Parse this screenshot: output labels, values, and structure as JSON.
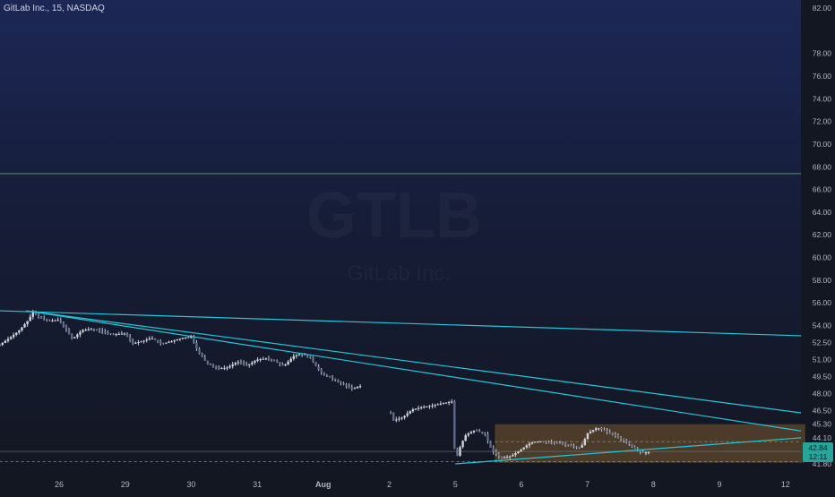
{
  "header": {
    "symbol_title": "GitLab Inc., 15, NASDAQ"
  },
  "watermark": {
    "ticker": "GTLB",
    "subtitle": "GitLab Inc."
  },
  "current_price": {
    "last": "42.84",
    "countdown": "12:11"
  },
  "colors": {
    "bg_top": "#1c2756",
    "bg_bottom": "#131722",
    "trendline": "#26c6da",
    "green_hline": "#4caf50",
    "box_fill": "#7a5a2e",
    "candle": "#d1d4dc",
    "axis_text": "#b2b5be",
    "price_tag": "#26a69a"
  },
  "chart_data": {
    "type": "candlestick",
    "y_axis": {
      "min": 41.0,
      "max": 82.9,
      "ticks": [
        "82.00",
        "78.00",
        "76.00",
        "74.00",
        "72.00",
        "70.00",
        "68.00",
        "66.00",
        "64.00",
        "62.00",
        "60.00",
        "58.00",
        "56.00",
        "54.00",
        "52.50",
        "51.00",
        "49.50",
        "48.00",
        "46.50",
        "45.30",
        "44.10",
        "41.80"
      ]
    },
    "x_axis": {
      "labels": [
        {
          "label": "26",
          "x": 0
        },
        {
          "label": "29",
          "x": 1
        },
        {
          "label": "30",
          "x": 2
        },
        {
          "label": "31",
          "x": 3
        },
        {
          "label": "Aug",
          "x": 4
        },
        {
          "label": "2",
          "x": 5
        },
        {
          "label": "5",
          "x": 6
        },
        {
          "label": "6",
          "x": 7
        },
        {
          "label": "7",
          "x": 8
        },
        {
          "label": "8",
          "x": 9
        },
        {
          "label": "9",
          "x": 10
        },
        {
          "label": "12",
          "x": 11
        }
      ],
      "range": [
        -0.9,
        11.3
      ]
    },
    "price_path": [
      [
        -0.9,
        52.3
      ],
      [
        -0.75,
        52.9
      ],
      [
        -0.6,
        53.6
      ],
      [
        -0.45,
        54.6
      ],
      [
        -0.4,
        55.3
      ],
      [
        -0.3,
        54.7
      ],
      [
        -0.15,
        54.4
      ],
      [
        0.0,
        54.5
      ],
      [
        0.1,
        53.7
      ],
      [
        0.2,
        52.8
      ],
      [
        0.35,
        53.6
      ],
      [
        0.5,
        53.7
      ],
      [
        0.65,
        53.5
      ],
      [
        0.8,
        53.2
      ],
      [
        1.0,
        53.3
      ],
      [
        1.1,
        52.4
      ],
      [
        1.25,
        52.6
      ],
      [
        1.4,
        52.9
      ],
      [
        1.55,
        52.4
      ],
      [
        1.7,
        52.6
      ],
      [
        1.85,
        52.9
      ],
      [
        2.0,
        53.0
      ],
      [
        2.1,
        51.7
      ],
      [
        2.25,
        50.6
      ],
      [
        2.4,
        50.2
      ],
      [
        2.55,
        50.3
      ],
      [
        2.7,
        50.8
      ],
      [
        2.85,
        50.5
      ],
      [
        3.0,
        51.0
      ],
      [
        3.15,
        51.1
      ],
      [
        3.3,
        50.8
      ],
      [
        3.4,
        50.4
      ],
      [
        3.55,
        51.3
      ],
      [
        3.65,
        51.5
      ],
      [
        3.8,
        51.2
      ],
      [
        3.9,
        50.3
      ],
      [
        4.0,
        49.7
      ],
      [
        4.15,
        49.3
      ],
      [
        4.3,
        48.8
      ],
      [
        4.45,
        48.4
      ],
      [
        4.55,
        48.7
      ],
      [
        4.6,
        48.5
      ],
      [
        5.0,
        46.8
      ],
      [
        5.05,
        45.6
      ],
      [
        5.2,
        45.9
      ],
      [
        5.35,
        46.6
      ],
      [
        5.5,
        46.8
      ],
      [
        5.7,
        47.0
      ],
      [
        5.85,
        47.2
      ],
      [
        5.95,
        47.3
      ],
      [
        6.0,
        41.8
      ],
      [
        6.05,
        43.0
      ],
      [
        6.15,
        44.3
      ],
      [
        6.3,
        44.8
      ],
      [
        6.45,
        44.4
      ],
      [
        6.55,
        43.0
      ],
      [
        6.7,
        42.3
      ],
      [
        6.85,
        42.5
      ],
      [
        7.0,
        43.1
      ],
      [
        7.15,
        43.7
      ],
      [
        7.3,
        43.8
      ],
      [
        7.45,
        43.7
      ],
      [
        7.6,
        43.6
      ],
      [
        7.75,
        43.4
      ],
      [
        7.9,
        43.2
      ],
      [
        8.0,
        44.5
      ],
      [
        8.15,
        45.0
      ],
      [
        8.3,
        44.6
      ],
      [
        8.45,
        44.2
      ],
      [
        8.6,
        43.7
      ],
      [
        8.75,
        43.0
      ],
      [
        8.85,
        42.8
      ],
      [
        8.95,
        42.84
      ]
    ],
    "horizontal_lines": [
      {
        "price": 67.4,
        "color": "green"
      },
      {
        "price": 42.9,
        "color": "gray"
      }
    ],
    "trendlines": [
      {
        "from": [
          -0.9,
          55.3
        ],
        "to": [
          11.3,
          53.1
        ]
      },
      {
        "from": [
          -0.5,
          55.3
        ],
        "to": [
          11.3,
          46.3
        ]
      },
      {
        "from": [
          -0.5,
          55.3
        ],
        "to": [
          11.3,
          44.7
        ]
      },
      {
        "from": [
          6.0,
          41.8
        ],
        "to": [
          11.3,
          44.1
        ]
      }
    ],
    "rectangle": {
      "x0": 6.6,
      "x1": 11.3,
      "y0": 45.3,
      "y1": 41.9
    },
    "dashed_lines": [
      {
        "price": 43.75,
        "from_x": 6.6,
        "to_x": 11.3
      },
      {
        "price": 42.0,
        "from_x": -0.9,
        "to_x": 11.3
      }
    ]
  }
}
